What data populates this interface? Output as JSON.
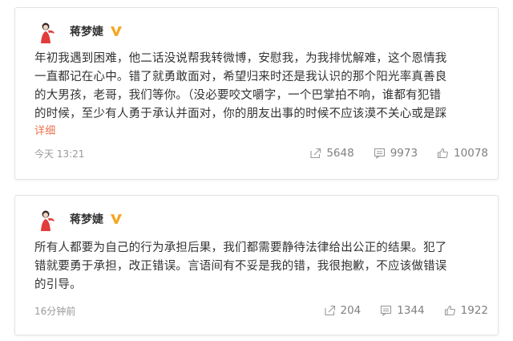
{
  "posts": [
    {
      "author": "蒋梦婕",
      "lines": [
        "年初我遇到困难，他二话没说帮我转微博，安慰我，为我排忧解难，这个恩情我",
        "一直都记在心中。错了就勇敢面对，希望归来时还是我认识的那个阳光率真善良",
        "的大男孩，老哥，我们等你。（没必要咬文嚼字，一个巴掌拍不响，谁都有犯错",
        "的时候，至少有人勇于承认并面对，你的朋友出事的时候不应该漠不关心或是踩"
      ],
      "more": "详细",
      "time": "今天 13:21",
      "reposts": "5648",
      "comments": "9973",
      "likes": "10078"
    },
    {
      "author": "蒋梦婕",
      "lines": [
        "所有人都要为自己的行为承担后果，我们都需要静待法律给出公正的结果。犯了",
        "错就要勇于承担，改正错误。言语间有不妥是我的错，我很抱歉，不应该做错误",
        "的引导。"
      ],
      "time": "16分钟前",
      "reposts": "204",
      "comments": "1344",
      "likes": "1922"
    }
  ],
  "colors": {
    "accent": "#eb7350",
    "verified": "#f5a623",
    "muted": "#999999"
  },
  "icons": {
    "verified": "v-badge-icon",
    "repost": "repost-icon",
    "comment": "comment-icon",
    "like": "thumbs-up-icon"
  }
}
